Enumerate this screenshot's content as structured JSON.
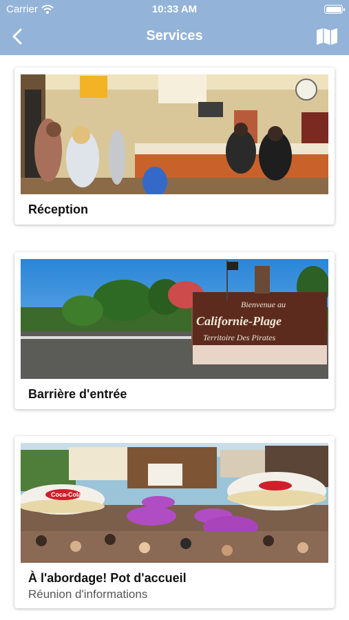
{
  "status_bar": {
    "carrier": "Carrier",
    "time": "10:33 AM"
  },
  "nav": {
    "title": "Services",
    "back_icon": "chevron-left-icon",
    "map_icon": "map-icon"
  },
  "services": [
    {
      "title": "Réception",
      "subtitle": "",
      "image": "reception-desk-photo"
    },
    {
      "title": "Barrière d'entrée",
      "subtitle": "",
      "image": "entrance-gate-photo"
    },
    {
      "title": "À l'abordage! Pot d'accueil",
      "subtitle": "Réunion d'informations",
      "image": "terrace-parasols-photo"
    }
  ],
  "sign_text": {
    "line1": "Bienvenue au",
    "line2": "Californie-Plage",
    "line3": "Territoire Des Pirates"
  },
  "parasol_brand": "Coca-Cola",
  "colors": {
    "header": "#93b4d8",
    "header_text": "#ffffff",
    "card_title": "#111111",
    "card_subtitle": "#555555"
  }
}
